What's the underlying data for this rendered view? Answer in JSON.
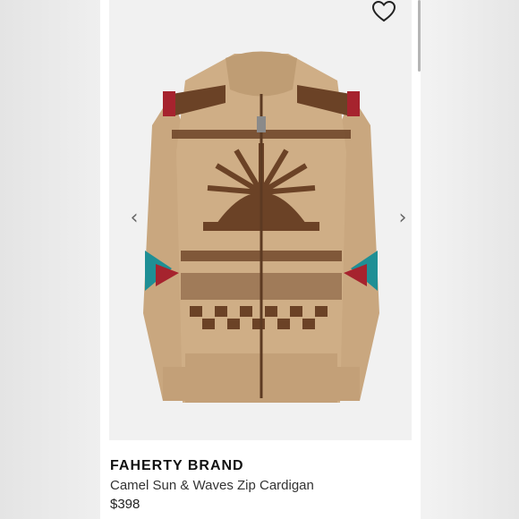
{
  "product": {
    "brand": "FAHERTY BRAND",
    "name": "Camel Sun & Waves Zip Cardigan",
    "price": "$398"
  },
  "controls": {
    "favorite_icon": "heart-outline-icon",
    "prev_icon": "chevron-left-icon",
    "next_icon": "chevron-right-icon",
    "prev_glyph": "‹",
    "next_glyph": "›"
  },
  "colors": {
    "camel": "#c9a77f",
    "brown": "#6b4226",
    "red": "#a6232e",
    "teal": "#1f8f95"
  }
}
